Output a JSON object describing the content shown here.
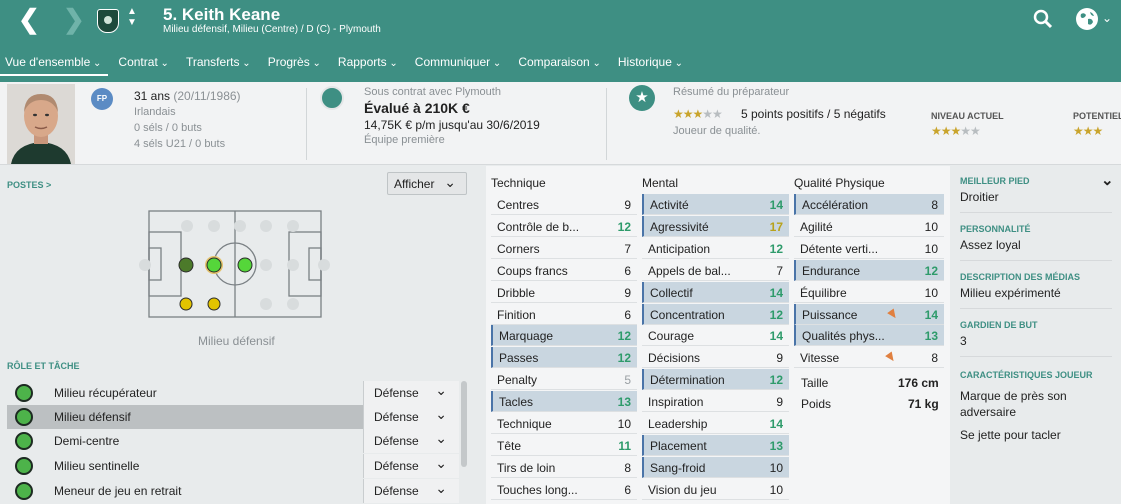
{
  "header": {
    "player_name": "5. Keith Keane",
    "subtitle": "Milieu défensif, Milieu (Centre) / D (C) - Plymouth"
  },
  "tabs": [
    {
      "label": "Vue d'ensemble"
    },
    {
      "label": "Contrat"
    },
    {
      "label": "Transferts"
    },
    {
      "label": "Progrès"
    },
    {
      "label": "Rapports"
    },
    {
      "label": "Communiquer"
    },
    {
      "label": "Comparaison"
    },
    {
      "label": "Historique"
    }
  ],
  "personal": {
    "age": "31 ans",
    "dob": "(20/11/1986)",
    "nationality": "Irlandais",
    "caps": "0 séls / 0 buts",
    "u21_caps": "4 séls U21 / 0 buts",
    "badge": "FP"
  },
  "contract": {
    "line1": "Sous contrat avec Plymouth",
    "value": "Évalué à 210K €",
    "wage": "14,75K € p/m jusqu'au 30/6/2019",
    "squad": "Équipe première"
  },
  "report": {
    "title": "Résumé du préparateur",
    "points": "5 points positifs / 5 négatifs",
    "quality": "Joueur de qualité.",
    "current_label": "NIVEAU ACTUEL",
    "potential_label": "POTENTIEL",
    "stars_summary": "3/5",
    "stars_current": "3/5",
    "stars_potential": "3/5"
  },
  "positions": {
    "title": "POSTES >",
    "afficher": "Afficher",
    "position_label": "Milieu défensif"
  },
  "roles": {
    "title": "RÔLE ET TÂCHE",
    "items": [
      {
        "name": "Milieu récupérateur",
        "duty": "Défense"
      },
      {
        "name": "Milieu défensif",
        "duty": "Défense"
      },
      {
        "name": "Demi-centre",
        "duty": "Défense"
      },
      {
        "name": "Milieu sentinelle",
        "duty": "Défense"
      },
      {
        "name": "Meneur de jeu en retrait",
        "duty": "Défense"
      }
    ]
  },
  "attributes": {
    "technique_title": "Technique",
    "mental_title": "Mental",
    "physical_title": "Qualité Physique",
    "technique": [
      {
        "n": "Centres",
        "v": "9"
      },
      {
        "n": "Contrôle de b...",
        "v": "12"
      },
      {
        "n": "Corners",
        "v": "7"
      },
      {
        "n": "Coups francs",
        "v": "6"
      },
      {
        "n": "Dribble",
        "v": "9"
      },
      {
        "n": "Finition",
        "v": "6"
      },
      {
        "n": "Marquage",
        "v": "12"
      },
      {
        "n": "Passes",
        "v": "12"
      },
      {
        "n": "Penalty",
        "v": "5"
      },
      {
        "n": "Tacles",
        "v": "13"
      },
      {
        "n": "Technique",
        "v": "10"
      },
      {
        "n": "Tête",
        "v": "11"
      },
      {
        "n": "Tirs de loin",
        "v": "8"
      },
      {
        "n": "Touches long...",
        "v": "6"
      }
    ],
    "mental": [
      {
        "n": "Activité",
        "v": "14"
      },
      {
        "n": "Agressivité",
        "v": "17"
      },
      {
        "n": "Anticipation",
        "v": "12"
      },
      {
        "n": "Appels de bal...",
        "v": "7"
      },
      {
        "n": "Collectif",
        "v": "14"
      },
      {
        "n": "Concentration",
        "v": "12"
      },
      {
        "n": "Courage",
        "v": "14"
      },
      {
        "n": "Décisions",
        "v": "9"
      },
      {
        "n": "Détermination",
        "v": "12"
      },
      {
        "n": "Inspiration",
        "v": "9"
      },
      {
        "n": "Leadership",
        "v": "14"
      },
      {
        "n": "Placement",
        "v": "13"
      },
      {
        "n": "Sang-froid",
        "v": "10"
      },
      {
        "n": "Vision du jeu",
        "v": "10"
      }
    ],
    "physical": [
      {
        "n": "Accélération",
        "v": "8"
      },
      {
        "n": "Agilité",
        "v": "10"
      },
      {
        "n": "Détente verti...",
        "v": "10"
      },
      {
        "n": "Endurance",
        "v": "12"
      },
      {
        "n": "Équilibre",
        "v": "10"
      },
      {
        "n": "Puissance",
        "v": "14"
      },
      {
        "n": "Qualités phys...",
        "v": "13"
      },
      {
        "n": "Vitesse",
        "v": "8"
      }
    ],
    "height_label": "Taille",
    "height": "176 cm",
    "weight_label": "Poids",
    "weight": "71 kg"
  },
  "side": {
    "foot_title": "MEILLEUR PIED",
    "foot": "Droitier",
    "personality_title": "PERSONNALITÉ",
    "personality": "Assez loyal",
    "media_title": "DESCRIPTION DES MÉDIAS",
    "media": "Milieu expérimenté",
    "gk_title": "GARDIEN DE BUT",
    "gk": "3",
    "traits_title": "CARACTÉRISTIQUES JOUEUR",
    "trait1a": "Marque de près son",
    "trait1b": "adversaire",
    "trait2": "Se jette pour tacler"
  },
  "colors": {
    "header": "#3e8f83",
    "highlight": "#c9d6e0",
    "green_value": "#2e9b6b",
    "gold_value": "#b8a21a"
  }
}
